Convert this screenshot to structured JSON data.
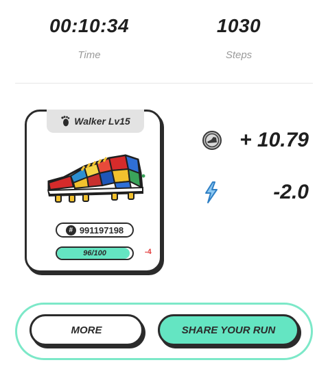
{
  "stats": {
    "time_value": "00:10:34",
    "time_label": "Time",
    "steps_value": "1030",
    "steps_label": "Steps"
  },
  "sneaker_card": {
    "level_label": "Walker Lv15",
    "level_icon": "footprint-icon",
    "shoe_id": "991197198",
    "id_icon": "#",
    "durability_text": "96/100",
    "durability_fraction": 0.96,
    "durability_change": "-4"
  },
  "rewards": {
    "token_icon": "sneaker-token-icon",
    "token_amount": "+ 10.79",
    "energy_icon": "lightning-icon",
    "energy_amount": "-2.0"
  },
  "actions": {
    "more_label": "MORE",
    "share_label": "SHARE YOUR RUN"
  },
  "colors": {
    "accent": "#64e5c2",
    "accent_border": "#7ce8c8",
    "negative": "#e23b3b",
    "energy": "#4aa3e0"
  }
}
